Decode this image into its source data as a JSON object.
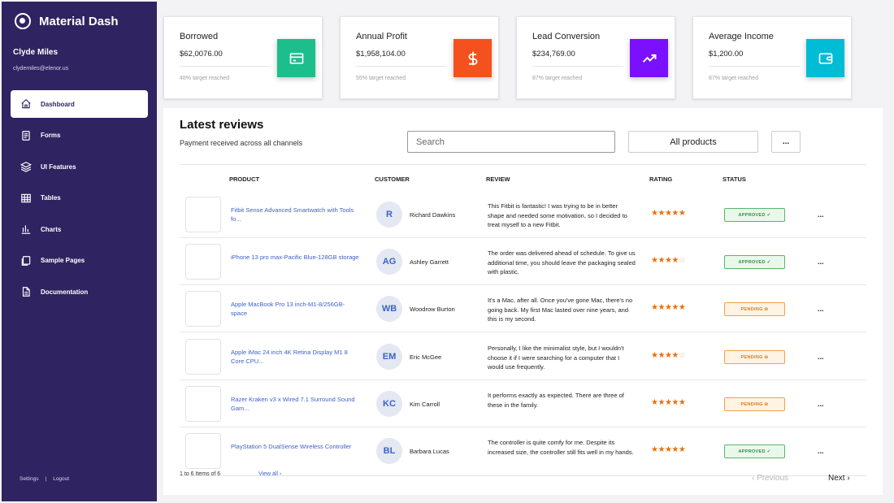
{
  "sidebar": {
    "brand": "Material Dash",
    "user_name": "Clyde Miles",
    "user_email": "clydemiles@elenor.us",
    "items": [
      {
        "label": "Dashboard",
        "icon": "home-icon",
        "active": true
      },
      {
        "label": "Forms",
        "icon": "forms-icon",
        "active": false
      },
      {
        "label": "UI Features",
        "icon": "layers-icon",
        "active": false
      },
      {
        "label": "Tables",
        "icon": "table-icon",
        "active": false
      },
      {
        "label": "Charts",
        "icon": "chart-icon",
        "active": false
      },
      {
        "label": "Sample Pages",
        "icon": "pages-icon",
        "active": false
      },
      {
        "label": "Documentation",
        "icon": "document-icon",
        "active": false
      }
    ],
    "footer": {
      "settings": "Settings",
      "separator": "|",
      "logout": "Logout"
    }
  },
  "cards": [
    {
      "title": "Borrowed",
      "value": "$62,0076.00",
      "sub": "48% target reached",
      "icon": "card-icon",
      "color": "#1cbf8b"
    },
    {
      "title": "Annual Profit",
      "value": "$1,958,104.00",
      "sub": "55% target reached",
      "icon": "dollar-icon",
      "color": "#f4511e"
    },
    {
      "title": "Lead Conversion",
      "value": "$234,769.00",
      "sub": "87% target reached",
      "icon": "trending-up-icon",
      "color": "#7b0fff"
    },
    {
      "title": "Average Income",
      "value": "$1,200.00",
      "sub": "87% target reached",
      "icon": "wallet-icon",
      "color": "#00bcd4"
    }
  ],
  "reviews": {
    "title": "Latest reviews",
    "subtitle": "Payment received across all channels",
    "search_placeholder": "Search",
    "filter_label": "All products",
    "more_label": "...",
    "columns": [
      "PRODUCT",
      "CUSTOMER",
      "REVIEW",
      "RATING",
      "STATUS"
    ],
    "rows": [
      {
        "product": "Fitbit Sense Advanced Smartwatch with Tools fo...",
        "initials": "R",
        "customer": "Richard Dawkins",
        "review": "This Fitbit is fantastic! I was trying to be in better shape and needed some motivation, so I decided to treat myself to a new Fitbit.",
        "rating": 5,
        "status": "APPROVED ✓",
        "status_type": "approved"
      },
      {
        "product": "iPhone 13 pro max-Pacific Blue-128GB storage",
        "initials": "AG",
        "customer": "Ashley Garrett",
        "review": "The order was delivered ahead of schedule. To give us additional time, you should leave the packaging sealed with plastic.",
        "rating": 3.5,
        "status": "APPROVED ✓",
        "status_type": "approved"
      },
      {
        "product": "Apple MacBook Pro 13 inch-M1-8/256GB-space",
        "initials": "WB",
        "customer": "Woodrow Burton",
        "review": "It's a Mac, after all. Once you've gone Mac, there's no going back. My first Mac lasted over nine years, and this is my second.",
        "rating": 5,
        "status": "PENDING ⊖",
        "status_type": "pending"
      },
      {
        "product": "Apple iMac 24 inch 4K Retina Display M1 8 Core CPU...",
        "initials": "EM",
        "customer": "Eric McGee",
        "review": "Personally, I like the minimalist style, but I wouldn't choose it if I were searching for a computer that I would use frequently.",
        "rating": 3.5,
        "status": "PENDING ⊖",
        "status_type": "pending"
      },
      {
        "product": "Razer Kraken v3 x Wired 7.1 Surround Sound Gam...",
        "initials": "KC",
        "customer": "Kim Carroll",
        "review": "It performs exactly as expected. There are three of these in the family.",
        "rating": 4.5,
        "status": "PENDING ⊖",
        "status_type": "pending"
      },
      {
        "product": "PlayStation 5 DualSense Wireless Controller",
        "initials": "BL",
        "customer": "Barbara Lucas",
        "review": "The controller is quite comfy for me. Despite its increased size, the controller still fits well in my hands.",
        "rating": 5,
        "status": "APPROVED ✓",
        "status_type": "approved"
      }
    ],
    "row_more": "...",
    "pagination": {
      "info": "1 to 6 Items of 6",
      "view_all": "View all ›",
      "prev": "‹ Previous",
      "next": "Next ›"
    }
  }
}
